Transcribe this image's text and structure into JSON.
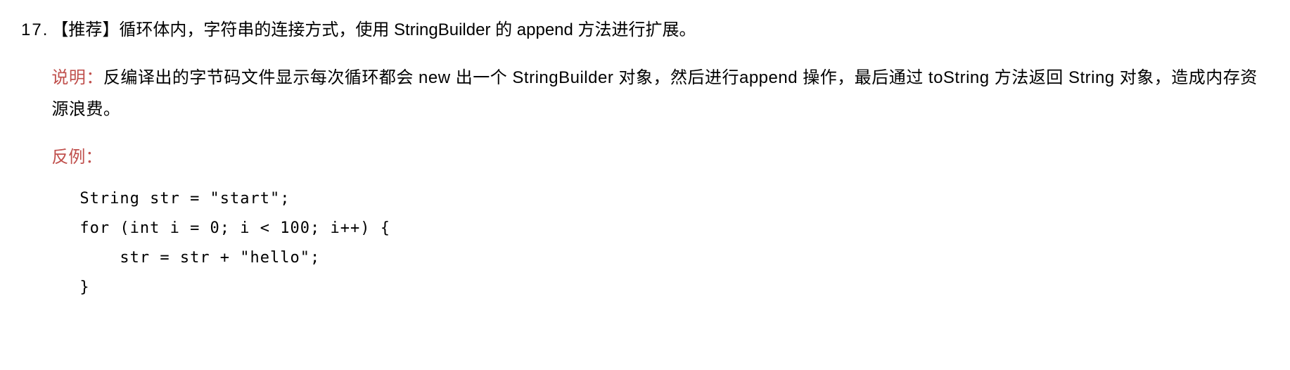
{
  "rule": {
    "number": "17.",
    "tag": "【推荐】",
    "title": "循环体内，字符串的连接方式，使用 StringBuilder 的 append 方法进行扩展。"
  },
  "explain": {
    "label": "说明：",
    "text": "反编译出的字节码文件显示每次循环都会 new 出一个 StringBuilder 对象，然后进行append 操作，最后通过 toString 方法返回 String 对象，造成内存资源浪费。"
  },
  "counterExample": {
    "label": "反例：",
    "code": "String str = \"start\";\nfor (int i = 0; i < 100; i++) {\n    str = str + \"hello\";\n}"
  }
}
